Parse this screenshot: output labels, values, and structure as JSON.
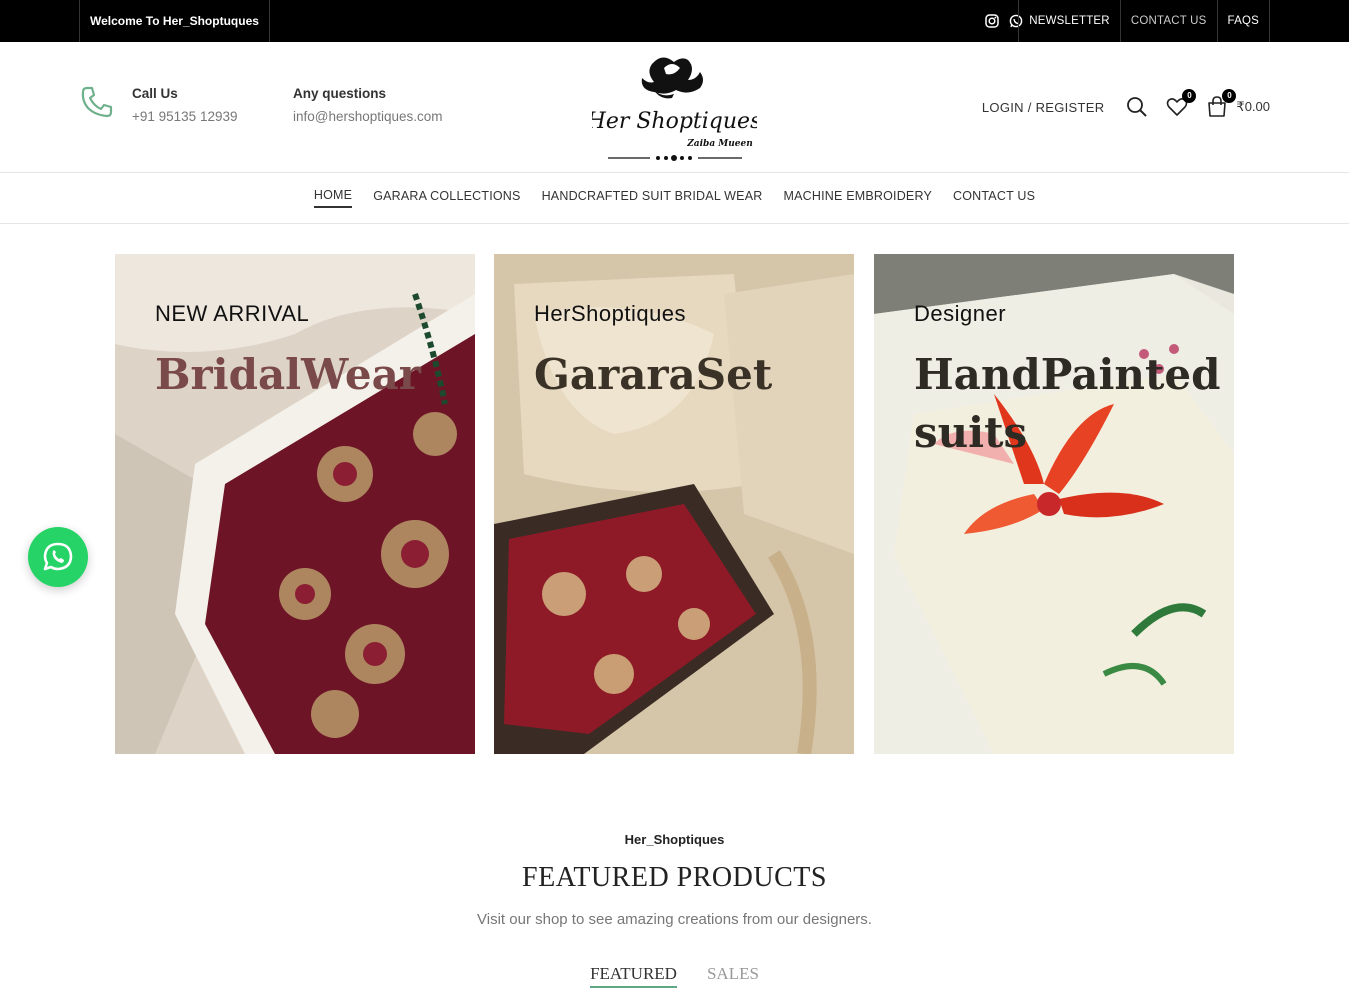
{
  "topbar": {
    "welcome": "Welcome To Her_Shoptuques",
    "social_icons": [
      "instagram-icon",
      "whatsapp-icon"
    ],
    "links": [
      "NEWSLETTER",
      "CONTACT US",
      "FAQS"
    ]
  },
  "header": {
    "call_title": "Call Us",
    "call_value": "+91 95135 12939",
    "questions_title": "Any questions",
    "questions_value": "info@hershoptiques.com",
    "logo_text": "Her Shoptiques",
    "logo_sub": "Zaiba Mueen",
    "login": "LOGIN / REGISTER",
    "wishlist_count": "0",
    "cart_count": "0",
    "cart_total": "₹0.00"
  },
  "nav": {
    "items": [
      "HOME",
      "GARARA COLLECTIONS",
      "HANDCRAFTED SUIT BRIDAL WEAR",
      "MACHINE EMBROIDERY",
      "CONTACT US"
    ],
    "active": "HOME"
  },
  "banners": [
    {
      "sub": "NEW ARRIVAL",
      "title": "BridalWear"
    },
    {
      "sub": "HerShoptiques",
      "title": "GararaSet"
    },
    {
      "sub": "Designer",
      "title": "HandPainted suits"
    }
  ],
  "featured": {
    "brand": "Her_Shoptiques",
    "title": "FEATURED PRODUCTS",
    "description": "Visit our shop to see amazing creations from our designers.",
    "tabs": [
      "FEATURED",
      "SALES"
    ],
    "active_tab": "FEATURED"
  },
  "colors": {
    "topbar_bg": "#000000",
    "phone_icon": "#6fb08c",
    "whatsapp": "#25d366",
    "tab_underline": "#5fa886"
  }
}
